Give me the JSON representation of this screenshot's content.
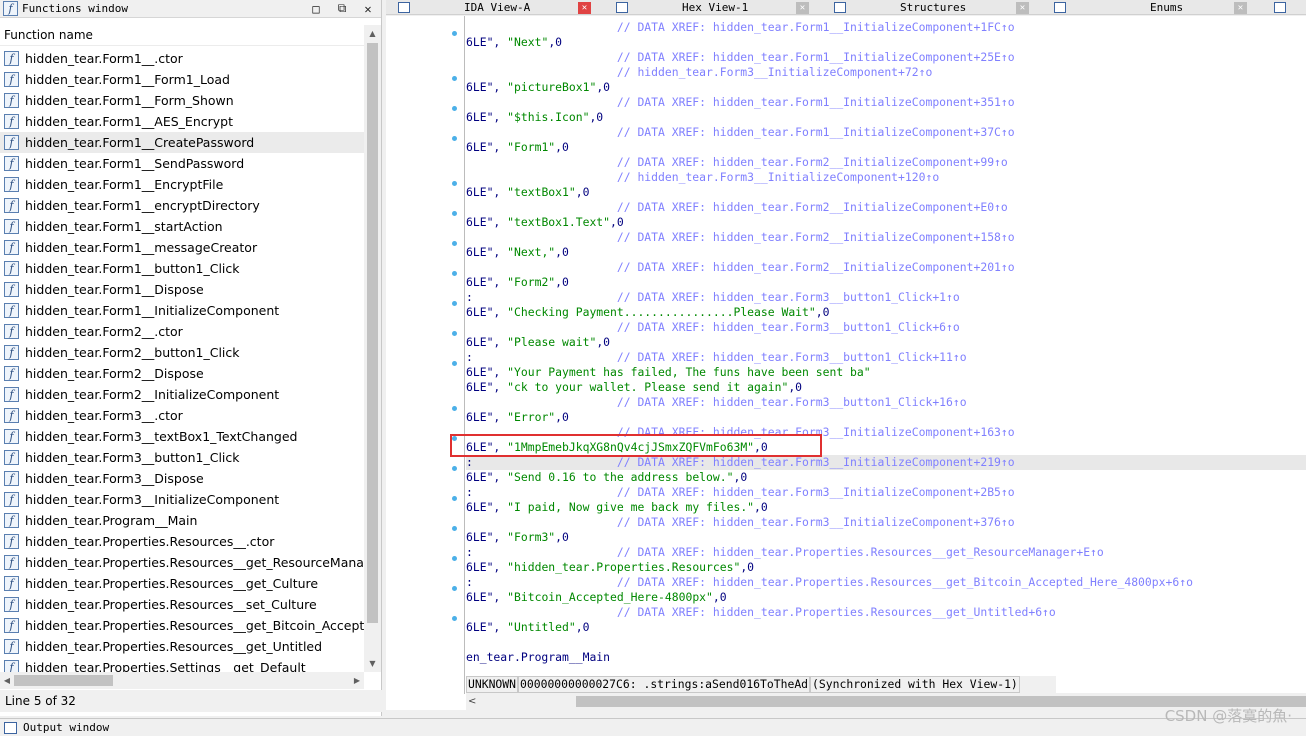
{
  "functions_window": {
    "title": "Functions window",
    "column_header": "Function name",
    "selected_index": 4,
    "items": [
      "hidden_tear.Form1__.ctor",
      "hidden_tear.Form1__Form1_Load",
      "hidden_tear.Form1__Form_Shown",
      "hidden_tear.Form1__AES_Encrypt",
      "hidden_tear.Form1__CreatePassword",
      "hidden_tear.Form1__SendPassword",
      "hidden_tear.Form1__EncryptFile",
      "hidden_tear.Form1__encryptDirectory",
      "hidden_tear.Form1__startAction",
      "hidden_tear.Form1__messageCreator",
      "hidden_tear.Form1__button1_Click",
      "hidden_tear.Form1__Dispose",
      "hidden_tear.Form1__InitializeComponent",
      "hidden_tear.Form2__.ctor",
      "hidden_tear.Form2__button1_Click",
      "hidden_tear.Form2__Dispose",
      "hidden_tear.Form2__InitializeComponent",
      "hidden_tear.Form3__.ctor",
      "hidden_tear.Form3__textBox1_TextChanged",
      "hidden_tear.Form3__button1_Click",
      "hidden_tear.Form3__Dispose",
      "hidden_tear.Form3__InitializeComponent",
      "hidden_tear.Program__Main",
      "hidden_tear.Properties.Resources__.ctor",
      "hidden_tear.Properties.Resources__get_ResourceManager",
      "hidden_tear.Properties.Resources__get_Culture",
      "hidden_tear.Properties.Resources__set_Culture",
      "hidden_tear.Properties.Resources__get_Bitcoin_Accepted_H",
      "hidden_tear.Properties.Resources__get_Untitled",
      "hidden_tear.Properties.Settings__get_Default"
    ],
    "status": "Line 5 of 32"
  },
  "tabs": [
    {
      "label": "IDA View-A",
      "active": true
    },
    {
      "label": "Hex View-1",
      "active": false
    },
    {
      "label": "Structures",
      "active": false
    },
    {
      "label": "Enums",
      "active": false
    }
  ],
  "ida_view": {
    "lines": [
      {
        "parts": [
          {
            "t": "                      // DATA XREF: hidden_tear.Form1__InitializeComponent+1FC↑o",
            "k": "c"
          }
        ]
      },
      {
        "dot": true,
        "parts": [
          {
            "t": "6LE\", ",
            "k": "b"
          },
          {
            "t": "\"Next\"",
            "k": "g"
          },
          {
            "t": ",0",
            "k": "b"
          }
        ]
      },
      {
        "parts": [
          {
            "t": "                      // DATA XREF: hidden_tear.Form1__InitializeComponent+25E↑o",
            "k": "c"
          }
        ]
      },
      {
        "parts": [
          {
            "t": "                      // hidden_tear.Form3__InitializeComponent+72↑o",
            "k": "c"
          }
        ]
      },
      {
        "dot": true,
        "parts": [
          {
            "t": "6LE\", ",
            "k": "b"
          },
          {
            "t": "\"pictureBox1\"",
            "k": "g"
          },
          {
            "t": ",0",
            "k": "b"
          }
        ]
      },
      {
        "parts": [
          {
            "t": "                      // DATA XREF: hidden_tear.Form1__InitializeComponent+351↑o",
            "k": "c"
          }
        ]
      },
      {
        "dot": true,
        "parts": [
          {
            "t": "6LE\", ",
            "k": "b"
          },
          {
            "t": "\"$this.Icon\"",
            "k": "g"
          },
          {
            "t": ",0",
            "k": "b"
          }
        ]
      },
      {
        "parts": [
          {
            "t": "                      // DATA XREF: hidden_tear.Form1__InitializeComponent+37C↑o",
            "k": "c"
          }
        ]
      },
      {
        "dot": true,
        "parts": [
          {
            "t": "6LE\", ",
            "k": "b"
          },
          {
            "t": "\"Form1\"",
            "k": "g"
          },
          {
            "t": ",0",
            "k": "b"
          }
        ]
      },
      {
        "parts": [
          {
            "t": "                      // DATA XREF: hidden_tear.Form2__InitializeComponent+99↑o",
            "k": "c"
          }
        ]
      },
      {
        "parts": [
          {
            "t": "                      // hidden_tear.Form3__InitializeComponent+120↑o",
            "k": "c"
          }
        ]
      },
      {
        "dot": true,
        "parts": [
          {
            "t": "6LE\", ",
            "k": "b"
          },
          {
            "t": "\"textBox1\"",
            "k": "g"
          },
          {
            "t": ",0",
            "k": "b"
          }
        ]
      },
      {
        "parts": [
          {
            "t": "                      // DATA XREF: hidden_tear.Form2__InitializeComponent+E0↑o",
            "k": "c"
          }
        ]
      },
      {
        "dot": true,
        "parts": [
          {
            "t": "6LE\", ",
            "k": "b"
          },
          {
            "t": "\"textBox1.Text\"",
            "k": "g"
          },
          {
            "t": ",0",
            "k": "b"
          }
        ]
      },
      {
        "parts": [
          {
            "t": "                      // DATA XREF: hidden_tear.Form2__InitializeComponent+158↑o",
            "k": "c"
          }
        ]
      },
      {
        "dot": true,
        "parts": [
          {
            "t": "6LE\", ",
            "k": "b"
          },
          {
            "t": "\"Next,\"",
            "k": "g"
          },
          {
            "t": ",0",
            "k": "b"
          }
        ]
      },
      {
        "parts": [
          {
            "t": "                      // DATA XREF: hidden_tear.Form2__InitializeComponent+201↑o",
            "k": "c"
          }
        ]
      },
      {
        "dot": true,
        "parts": [
          {
            "t": "6LE\", ",
            "k": "b"
          },
          {
            "t": "\"Form2\"",
            "k": "g"
          },
          {
            "t": ",0",
            "k": "b"
          }
        ]
      },
      {
        "parts": [
          {
            "t": ":",
            "k": "b"
          },
          {
            "t": "                     // DATA XREF: hidden_tear.Form3__button1_Click+1↑o",
            "k": "c"
          }
        ]
      },
      {
        "dot": true,
        "parts": [
          {
            "t": "6LE\", ",
            "k": "b"
          },
          {
            "t": "\"Checking Payment................Please Wait\"",
            "k": "g"
          },
          {
            "t": ",0",
            "k": "b"
          }
        ]
      },
      {
        "parts": [
          {
            "t": "                      // DATA XREF: hidden_tear.Form3__button1_Click+6↑o",
            "k": "c"
          }
        ]
      },
      {
        "dot": true,
        "parts": [
          {
            "t": "6LE\", ",
            "k": "b"
          },
          {
            "t": "\"Please wait\"",
            "k": "g"
          },
          {
            "t": ",0",
            "k": "b"
          }
        ]
      },
      {
        "parts": [
          {
            "t": ":",
            "k": "b"
          },
          {
            "t": "                     // DATA XREF: hidden_tear.Form3__button1_Click+11↑o",
            "k": "c"
          }
        ]
      },
      {
        "dot": true,
        "parts": [
          {
            "t": "6LE\", ",
            "k": "b"
          },
          {
            "t": "\"Your Payment has failed, The funs have been sent ba\"",
            "k": "g"
          }
        ]
      },
      {
        "parts": [
          {
            "t": "6LE\", ",
            "k": "b"
          },
          {
            "t": "\"ck to your wallet. Please send it again\"",
            "k": "g"
          },
          {
            "t": ",0",
            "k": "b"
          }
        ]
      },
      {
        "parts": [
          {
            "t": "                      // DATA XREF: hidden_tear.Form3__button1_Click+16↑o",
            "k": "c"
          }
        ]
      },
      {
        "dot": true,
        "parts": [
          {
            "t": "6LE\", ",
            "k": "b"
          },
          {
            "t": "\"Error\"",
            "k": "g"
          },
          {
            "t": ",0",
            "k": "b"
          }
        ]
      },
      {
        "parts": [
          {
            "t": "                      // DATA XREF: hidden_tear.Form3__InitializeComponent+163↑o",
            "k": "c"
          }
        ]
      },
      {
        "dot": true,
        "parts": [
          {
            "t": "6LE\", ",
            "k": "b"
          },
          {
            "t": "\"1MmpEmebJkqXG8nQv4cjJSmxZQFVmFo63M\"",
            "k": "g"
          },
          {
            "t": ",0",
            "k": "b"
          }
        ]
      },
      {
        "hl": true,
        "parts": [
          {
            "t": ":",
            "k": "b"
          },
          {
            "t": "                     // DATA XREF: hidden_tear.Form3__InitializeComponent+219↑o",
            "k": "c"
          }
        ]
      },
      {
        "dot": true,
        "parts": [
          {
            "t": "6LE\", ",
            "k": "b"
          },
          {
            "t": "\"Send 0.16 to the address below.\"",
            "k": "g"
          },
          {
            "t": ",0",
            "k": "b"
          }
        ]
      },
      {
        "parts": [
          {
            "t": ":",
            "k": "b"
          },
          {
            "t": "                     // DATA XREF: hidden_tear.Form3__InitializeComponent+2B5↑o",
            "k": "c"
          }
        ]
      },
      {
        "dot": true,
        "parts": [
          {
            "t": "6LE\", ",
            "k": "b"
          },
          {
            "t": "\"I paid, Now give me back my files.\"",
            "k": "g"
          },
          {
            "t": ",0",
            "k": "b"
          }
        ]
      },
      {
        "parts": [
          {
            "t": "                      // DATA XREF: hidden_tear.Form3__InitializeComponent+376↑o",
            "k": "c"
          }
        ]
      },
      {
        "dot": true,
        "parts": [
          {
            "t": "6LE\", ",
            "k": "b"
          },
          {
            "t": "\"Form3\"",
            "k": "g"
          },
          {
            "t": ",0",
            "k": "b"
          }
        ]
      },
      {
        "parts": [
          {
            "t": ":",
            "k": "b"
          },
          {
            "t": "                     // DATA XREF: hidden_tear.Properties.Resources__get_ResourceManager+E↑o",
            "k": "c"
          }
        ]
      },
      {
        "dot": true,
        "parts": [
          {
            "t": "6LE\", ",
            "k": "b"
          },
          {
            "t": "\"hidden_tear.Properties.Resources\"",
            "k": "g"
          },
          {
            "t": ",0",
            "k": "b"
          }
        ]
      },
      {
        "parts": [
          {
            "t": ":",
            "k": "b"
          },
          {
            "t": "                     // DATA XREF: hidden_tear.Properties.Resources__get_Bitcoin_Accepted_Here_4800px+6↑o",
            "k": "c"
          }
        ]
      },
      {
        "dot": true,
        "parts": [
          {
            "t": "6LE\", ",
            "k": "b"
          },
          {
            "t": "\"Bitcoin_Accepted_Here-4800px\"",
            "k": "g"
          },
          {
            "t": ",0",
            "k": "b"
          }
        ]
      },
      {
        "parts": [
          {
            "t": "                      // DATA XREF: hidden_tear.Properties.Resources__get_Untitled+6↑o",
            "k": "c"
          }
        ]
      },
      {
        "dot": true,
        "parts": [
          {
            "t": "6LE\", ",
            "k": "b"
          },
          {
            "t": "\"Untitled\"",
            "k": "g"
          },
          {
            "t": ",0",
            "k": "b"
          }
        ]
      },
      {
        "parts": [
          {
            "t": "",
            "k": "b"
          }
        ]
      },
      {
        "parts": [
          {
            "t": "en_tear.Program__Main",
            "k": "b"
          }
        ]
      }
    ],
    "status": {
      "mode": "UNKNOWN",
      "location": "00000000000027C6: .strings:aSend016ToTheAd",
      "sync": "(Synchronized with Hex View-1)"
    }
  },
  "output_window": {
    "title": "Output window"
  },
  "watermark": "CSDN @落寞的魚·"
}
